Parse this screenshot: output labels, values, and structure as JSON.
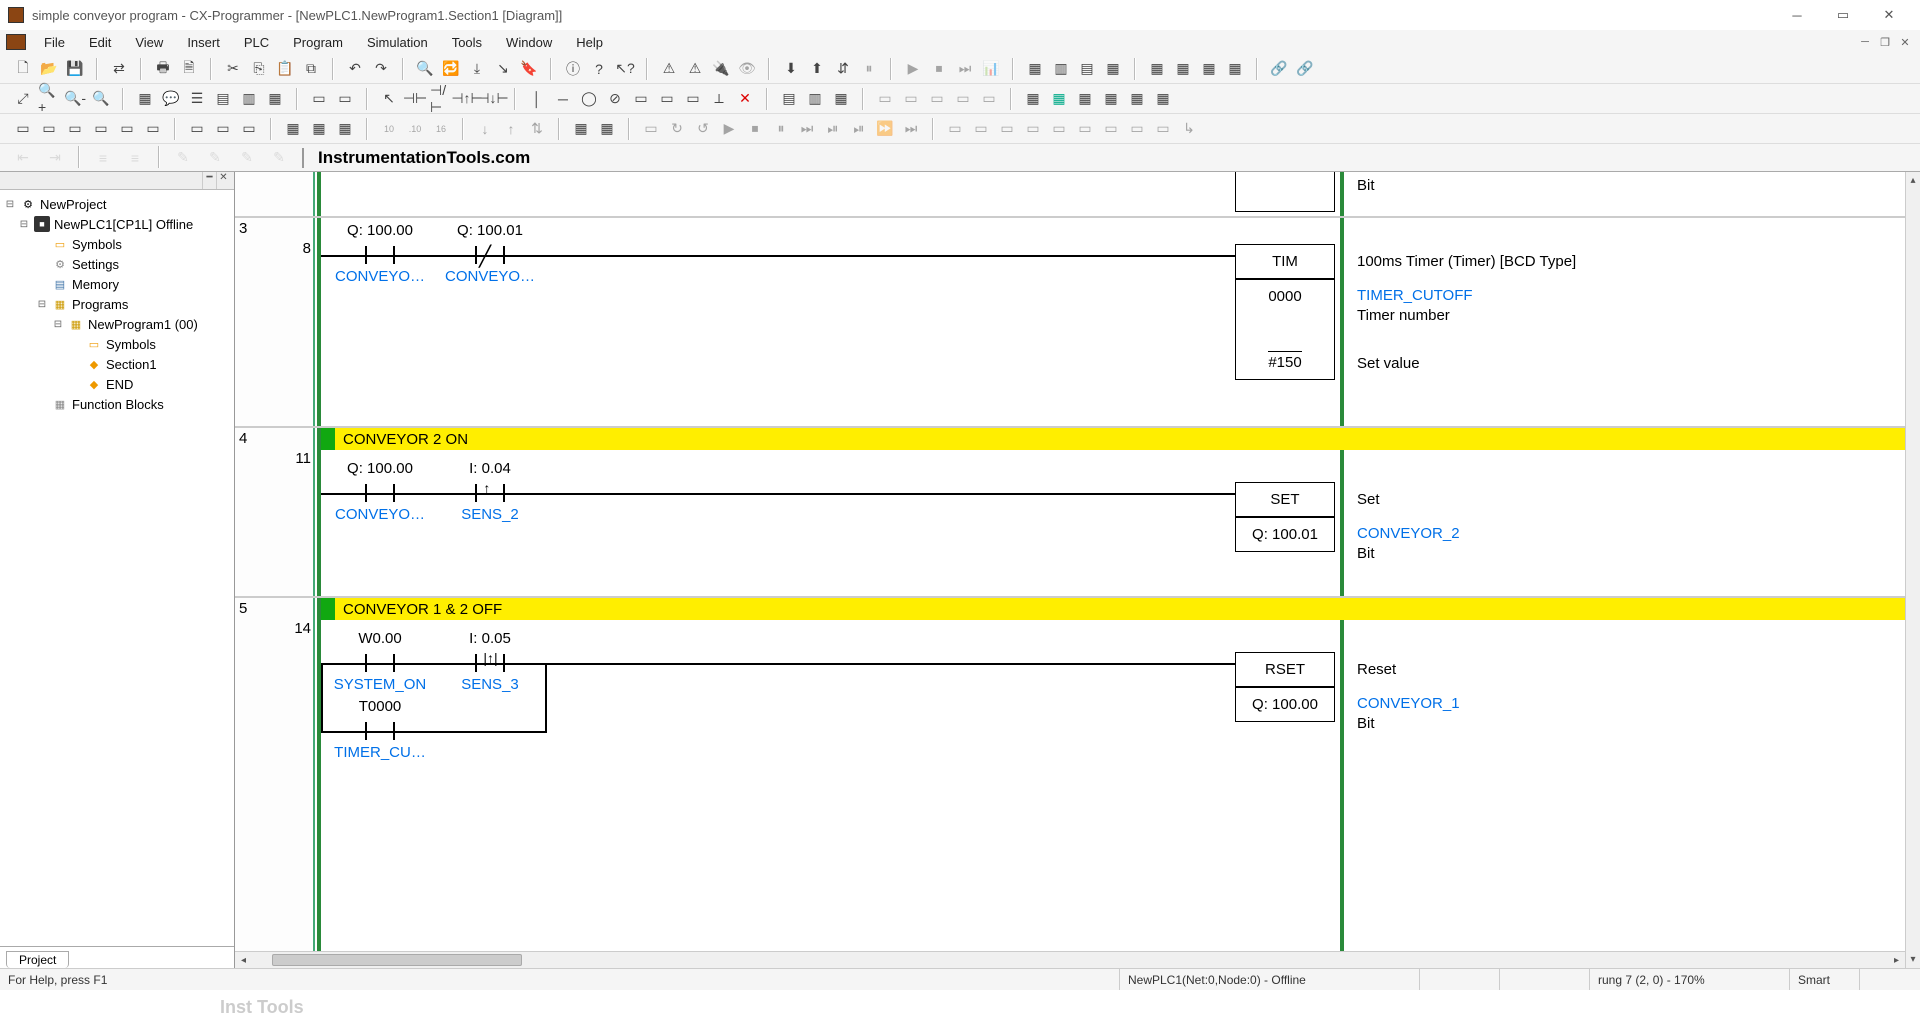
{
  "window": {
    "title": "simple conveyor program - CX-Programmer - [NewPLC1.NewProgram1.Section1 [Diagram]]"
  },
  "menus": [
    "File",
    "Edit",
    "View",
    "Insert",
    "PLC",
    "Program",
    "Simulation",
    "Tools",
    "Window",
    "Help"
  ],
  "brand": "InstrumentationTools.com",
  "tree": {
    "root": "NewProject",
    "plc": "NewPLC1[CP1L] Offline",
    "symbols": "Symbols",
    "settings": "Settings",
    "memory": "Memory",
    "programs": "Programs",
    "program1": "NewProgram1 (00)",
    "p_symbols": "Symbols",
    "p_section1": "Section1",
    "p_end": "END",
    "fblocks": "Function Blocks"
  },
  "sidebar_tab": "Project",
  "rungs": {
    "r2": {
      "num": "",
      "step": ""
    },
    "r3": {
      "num": "3",
      "step": "8",
      "c1_addr": "Q: 100.00",
      "c1_name": "CONVEYO…",
      "c2_addr": "Q: 100.01",
      "c2_name": "CONVEYO…",
      "box_op": "TIM",
      "box_v1": "0000",
      "box_v2": "#150",
      "d0": "Bit",
      "d1": "100ms Timer (Timer) [BCD Type]",
      "d2": "TIMER_CUTOFF",
      "d3": "Timer number",
      "d4": "Set value"
    },
    "r4": {
      "num": "4",
      "step": "11",
      "title": "CONVEYOR 2 ON",
      "c1_addr": "Q: 100.00",
      "c1_name": "CONVEYO…",
      "c2_addr": "I: 0.04",
      "c2_name": "SENS_2",
      "box_op": "SET",
      "box_v1": "Q: 100.01",
      "d1": "Set",
      "d2": "CONVEYOR_2",
      "d3": "Bit"
    },
    "r5": {
      "num": "5",
      "step": "14",
      "title": "CONVEYOR 1 & 2 OFF",
      "c1_addr": "W0.00",
      "c1_name": "SYSTEM_ON",
      "c2_addr": "I: 0.05",
      "c2_name": "SENS_3",
      "c3_addr": "T0000",
      "c3_name": "TIMER_CU…",
      "box_op": "RSET",
      "box_v1": "Q: 100.00",
      "d1": "Reset",
      "d2": "CONVEYOR_1",
      "d3": "Bit"
    }
  },
  "status": {
    "help": "For Help, press F1",
    "watermark": "Inst Tools",
    "conn": "NewPLC1(Net:0,Node:0) - Offline",
    "pos": "rung 7 (2, 0)  - 170%",
    "mode": "Smart"
  }
}
